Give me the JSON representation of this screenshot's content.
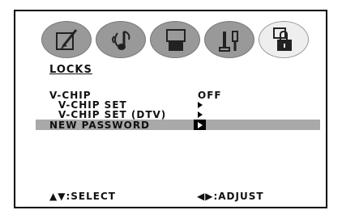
{
  "menu": {
    "title": "LOCKS",
    "tabs": [
      {
        "icon": "picture-icon",
        "active": false
      },
      {
        "icon": "music-note-icon",
        "active": false
      },
      {
        "icon": "tv-icon",
        "active": false
      },
      {
        "icon": "tools-icon",
        "active": false
      },
      {
        "icon": "lock-icon",
        "active": true
      }
    ],
    "items": [
      {
        "label": "V-CHIP",
        "value": "OFF"
      },
      {
        "label": "V-CHIP SET",
        "value": ""
      },
      {
        "label": "V-CHIP SET (DTV)",
        "value": ""
      },
      {
        "label": "NEW PASSWORD",
        "value": "",
        "selected": true
      }
    ]
  },
  "footer": {
    "select": ":SELECT",
    "adjust": ":ADJUST"
  },
  "colors": {
    "highlight": "#a9a9a9",
    "tab_inactive": "#999999",
    "tab_active": "#eeeeee"
  }
}
